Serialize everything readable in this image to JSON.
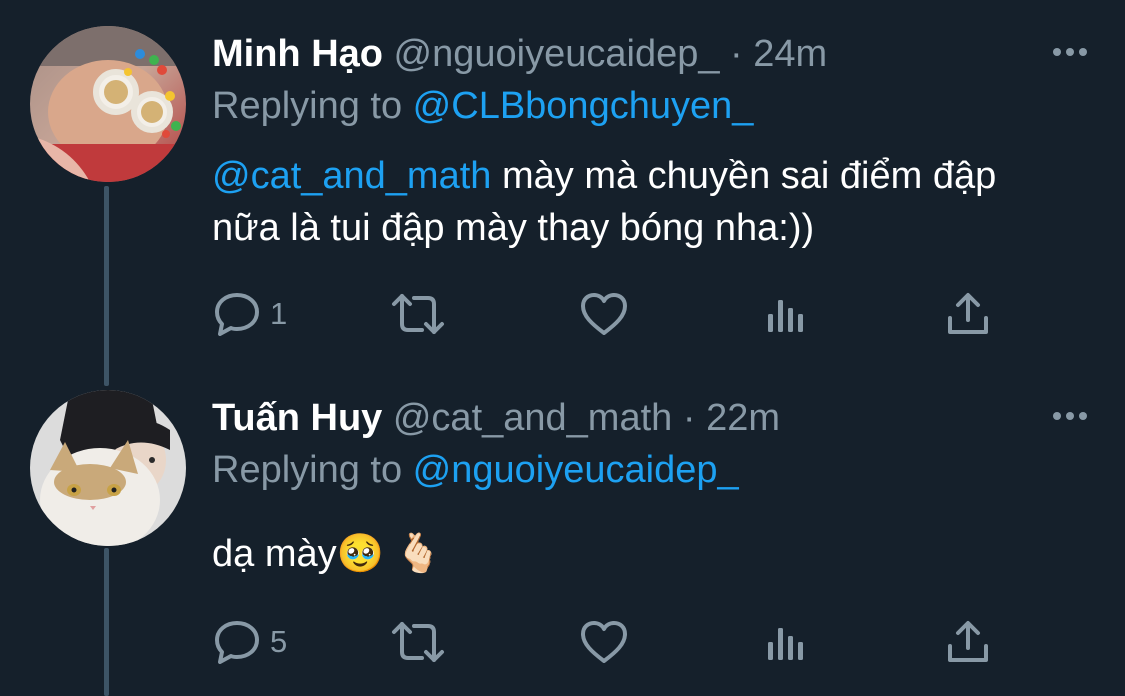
{
  "tweets": [
    {
      "name": "Minh Hạo",
      "handle": "@nguoiyeucaidep_",
      "separator": "·",
      "time": "24m",
      "replying_prefix": "Replying to ",
      "replying_to": "@CLBbongchuyen_",
      "mention": "@cat_and_math",
      "text": " mày mà chuyền sai điểm đập nữa là tui đập mày thay bóng nha:))",
      "reply_count": "1",
      "icons": [
        "reply-icon",
        "retweet-icon",
        "like-icon",
        "analytics-icon",
        "share-icon",
        "more-icon"
      ]
    },
    {
      "name": "Tuấn Huy",
      "handle": "@cat_and_math",
      "separator": "·",
      "time": "22m",
      "replying_prefix": "Replying to ",
      "replying_to": "@nguoiyeucaidep_",
      "text": "dạ mày🥹 🫰🏻",
      "reply_count": "5",
      "icons": [
        "reply-icon",
        "retweet-icon",
        "like-icon",
        "analytics-icon",
        "share-icon",
        "more-icon"
      ]
    }
  ],
  "colors": {
    "background": "#15202b",
    "text": "#ffffff",
    "secondary": "#8899a6",
    "link": "#1da1f2",
    "thread_line": "#3d5466"
  }
}
